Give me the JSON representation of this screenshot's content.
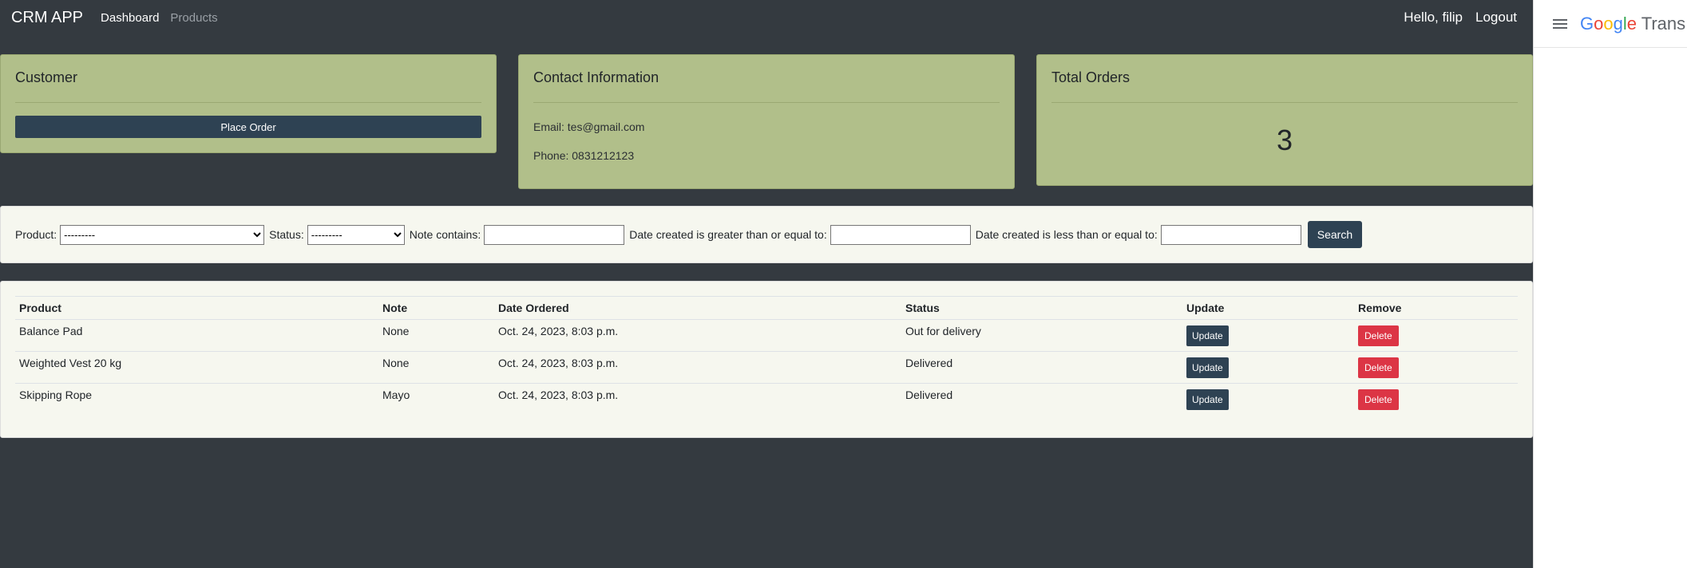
{
  "navbar": {
    "brand": "CRM APP",
    "links": [
      "Dashboard",
      "Products"
    ],
    "greeting": "Hello, filip",
    "logout": "Logout"
  },
  "customer_card": {
    "title": "Customer",
    "place_order": "Place Order"
  },
  "contact_card": {
    "title": "Contact Information",
    "email": "Email: tes@gmail.com",
    "phone": "Phone: 0831212123"
  },
  "orders_card": {
    "title": "Total Orders",
    "count": "3"
  },
  "filter": {
    "product_label": "Product:",
    "product_value": "---------",
    "status_label": "Status:",
    "status_value": "---------",
    "note_label": "Note contains:",
    "date_gte_label": "Date created is greater than or equal to:",
    "date_lte_label": "Date created is less than or equal to:",
    "search": "Search"
  },
  "table": {
    "headers": [
      "Product",
      "Note",
      "Date Ordered",
      "Status",
      "Update",
      "Remove"
    ],
    "rows": [
      {
        "product": "Balance Pad",
        "note": "None",
        "date": "Oct. 24, 2023, 8:03 p.m.",
        "status": "Out for delivery",
        "update": "Update",
        "remove": "Delete"
      },
      {
        "product": "Weighted Vest 20 kg",
        "note": "None",
        "date": "Oct. 24, 2023, 8:03 p.m.",
        "status": "Delivered",
        "update": "Update",
        "remove": "Delete"
      },
      {
        "product": "Skipping Rope",
        "note": "Mayo",
        "date": "Oct. 24, 2023, 8:03 p.m.",
        "status": "Delivered",
        "update": "Update",
        "remove": "Delete"
      }
    ]
  },
  "translate_panel": {
    "logo_letters": [
      "G",
      "o",
      "o",
      "g",
      "l",
      "e"
    ],
    "logo_suffix": " Trans",
    "menu_icon": "hamburger-menu-icon"
  },
  "colors": {
    "background": "#343a40",
    "card": "#b1bf8a",
    "panel": "#f6f7ef",
    "primary_button": "#2e4253",
    "danger_button": "#dc3545"
  }
}
